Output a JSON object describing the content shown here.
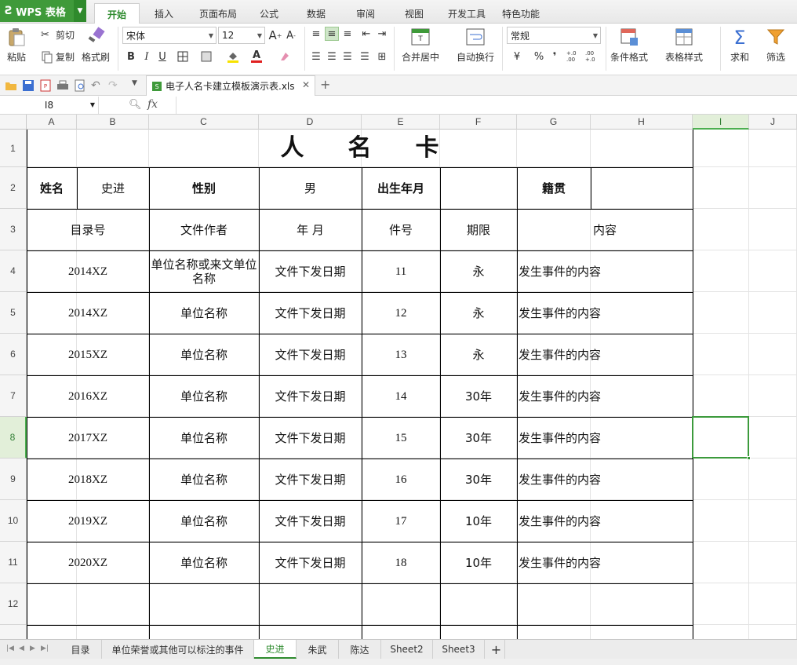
{
  "app": {
    "name": "WPS 表格"
  },
  "menu": {
    "tabs": [
      "开始",
      "插入",
      "页面布局",
      "公式",
      "数据",
      "审阅",
      "视图",
      "开发工具",
      "特色功能"
    ],
    "active": "开始"
  },
  "ribbon": {
    "paste": "粘贴",
    "cut": "剪切",
    "copy": "复制",
    "format_painter": "格式刷",
    "font_name": "宋体",
    "font_size": "12",
    "bold": "B",
    "italic": "I",
    "underline": "U",
    "merge_center": "合并居中",
    "wrap_text": "自动换行",
    "number_format": "常规",
    "percent": "%",
    "comma": "❜",
    "inc_decimal": "+.0 .00",
    "dec_decimal": ".00 +.0",
    "conditional_format": "条件格式",
    "table_style": "表格样式",
    "sum": "求和",
    "filter": "筛选"
  },
  "document": {
    "tab_title": "电子人名卡建立模板演示表.xls"
  },
  "formula_bar": {
    "cell_ref": "I8",
    "fx": "fx",
    "value": ""
  },
  "columns": [
    "A",
    "B",
    "C",
    "D",
    "E",
    "F",
    "G",
    "H",
    "I",
    "J"
  ],
  "rows": [
    "1",
    "2",
    "3",
    "4",
    "5",
    "6",
    "7",
    "8",
    "9",
    "10",
    "11",
    "12"
  ],
  "selected_cell": "I8",
  "sheet": {
    "title": "人名卡",
    "row2": {
      "name_label": "姓名",
      "name_value": "史进",
      "gender_label": "性别",
      "gender_value": "男",
      "birth_label": "出生年月",
      "birth_value": "",
      "native_label": "籍贯",
      "native_value": ""
    },
    "headers": [
      "目录号",
      "文件作者",
      "年  月",
      "件号",
      "期限",
      "内容"
    ],
    "records": [
      [
        "2014XZ",
        "单位名称或来文单位名称",
        "文件下发日期",
        "11",
        "永",
        "发生事件的内容"
      ],
      [
        "2014XZ",
        "单位名称",
        "文件下发日期",
        "12",
        "永",
        "发生事件的内容"
      ],
      [
        "2015XZ",
        "单位名称",
        "文件下发日期",
        "13",
        "永",
        "发生事件的内容"
      ],
      [
        "2016XZ",
        "单位名称",
        "文件下发日期",
        "14",
        "30年",
        "发生事件的内容"
      ],
      [
        "2017XZ",
        "单位名称",
        "文件下发日期",
        "15",
        "30年",
        "发生事件的内容"
      ],
      [
        "2018XZ",
        "单位名称",
        "文件下发日期",
        "16",
        "30年",
        "发生事件的内容"
      ],
      [
        "2019XZ",
        "单位名称",
        "文件下发日期",
        "17",
        "10年",
        "发生事件的内容"
      ],
      [
        "2020XZ",
        "单位名称",
        "文件下发日期",
        "18",
        "10年",
        "发生事件的内容"
      ]
    ]
  },
  "sheet_tabs": {
    "tabs": [
      "目录",
      "单位荣誉或其他可以标注的事件",
      "史进",
      "朱武",
      "陈达",
      "Sheet2",
      "Sheet3"
    ],
    "active": "史进",
    "add": "+"
  },
  "colors": {
    "accent": "#3f9a3a",
    "selection": "#3c9a3c",
    "header_bg": "#f5f5f5"
  }
}
